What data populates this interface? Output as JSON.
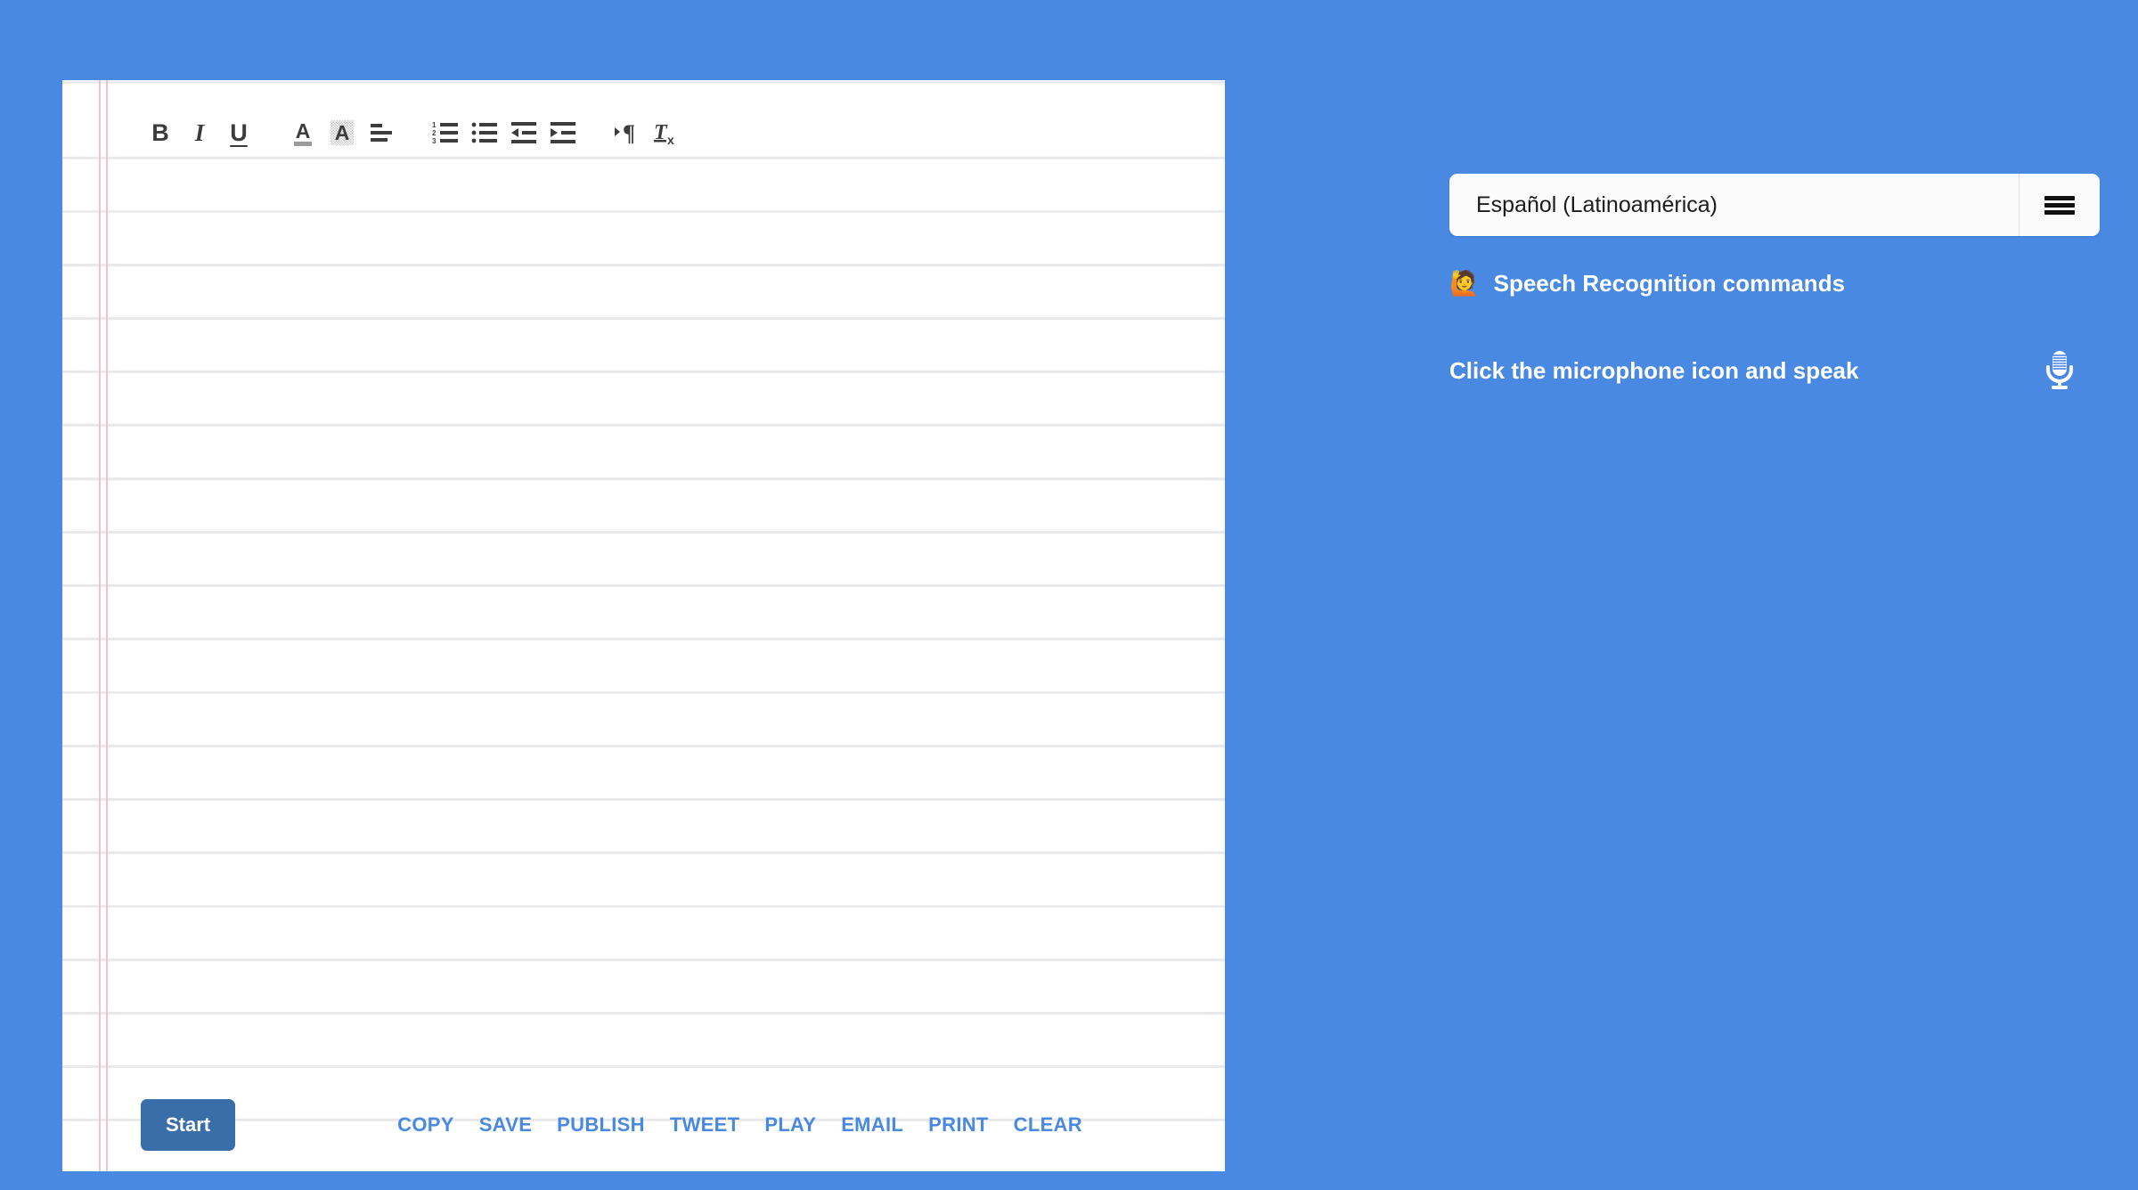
{
  "theme": {
    "background": "#4a89e2",
    "paper": "#ffffff",
    "rule_line": "#e9e9e9",
    "margin_line": "#f3c2cf",
    "accent_link": "#4a89e2",
    "start_button_bg": "#3a6ea8",
    "toolbar_icon": "#3c3c3c"
  },
  "editor": {
    "toolbar": {
      "buttons": [
        {
          "name": "bold",
          "glyph": "B",
          "title": "Bold"
        },
        {
          "name": "italic",
          "glyph": "I",
          "title": "Italic"
        },
        {
          "name": "underline",
          "glyph": "U",
          "title": "Underline"
        },
        {
          "name": "text-color",
          "glyph": "A",
          "title": "Text color"
        },
        {
          "name": "highlight-color",
          "glyph": "A",
          "title": "Highlight color"
        },
        {
          "name": "align",
          "glyph": "",
          "title": "Align"
        },
        {
          "name": "ordered-list",
          "glyph": "123",
          "title": "Numbered list"
        },
        {
          "name": "unordered-list",
          "glyph": "",
          "title": "Bulleted list"
        },
        {
          "name": "outdent",
          "glyph": "",
          "title": "Decrease indent"
        },
        {
          "name": "indent",
          "glyph": "",
          "title": "Increase indent"
        },
        {
          "name": "text-direction",
          "glyph": "¶",
          "title": "Text direction"
        },
        {
          "name": "clear-formatting",
          "glyph": "Tx",
          "title": "Remove formatting"
        }
      ]
    },
    "content": "",
    "start_button_label": "Start",
    "action_links": [
      "COPY",
      "SAVE",
      "PUBLISH",
      "TWEET",
      "PLAY",
      "EMAIL",
      "PRINT",
      "CLEAR"
    ]
  },
  "panel": {
    "language": {
      "selected": "Español (Latinoamérica)",
      "menu_icon": "hamburger-icon"
    },
    "commands": {
      "emoji": "🙋",
      "label": "Speech Recognition commands"
    },
    "microphone": {
      "hint": "Click the microphone icon and speak",
      "icon": "microphone-icon"
    }
  }
}
